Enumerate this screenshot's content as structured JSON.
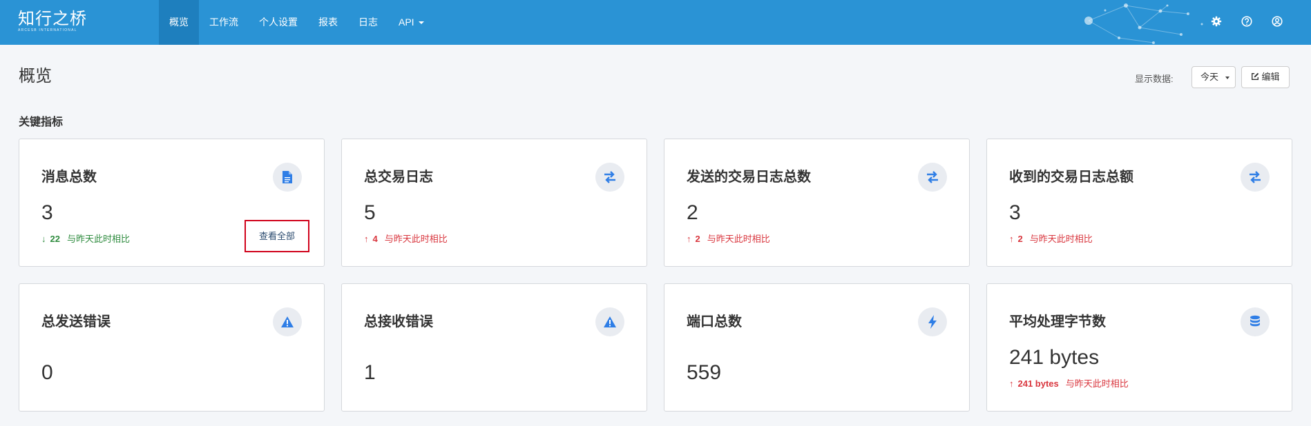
{
  "brand": {
    "name": "知行之桥",
    "subtitle": "ARCESB INTERNATIONAL"
  },
  "nav": {
    "items": [
      {
        "label": "概览",
        "active": true
      },
      {
        "label": "工作流",
        "active": false
      },
      {
        "label": "个人设置",
        "active": false
      },
      {
        "label": "报表",
        "active": false
      },
      {
        "label": "日志",
        "active": false
      }
    ],
    "api_label": "API"
  },
  "header_icons": [
    "gear-icon",
    "help-icon",
    "user-icon"
  ],
  "page": {
    "title": "概览",
    "display_label": "显示数据:",
    "period": "今天",
    "edit_label": "编辑",
    "section_title": "关键指标"
  },
  "cards": [
    {
      "title": "消息总数",
      "value": "3",
      "delta": "22",
      "direction": "down",
      "compare": "与昨天此时相比",
      "icon": "file-icon",
      "action": "查看全部"
    },
    {
      "title": "总交易日志",
      "value": "5",
      "delta": "4",
      "direction": "up",
      "compare": "与昨天此时相比",
      "icon": "exchange-icon"
    },
    {
      "title": "发送的交易日志总数",
      "value": "2",
      "delta": "2",
      "direction": "up",
      "compare": "与昨天此时相比",
      "icon": "exchange-icon"
    },
    {
      "title": "收到的交易日志总额",
      "value": "3",
      "delta": "2",
      "direction": "up",
      "compare": "与昨天此时相比",
      "icon": "exchange-icon"
    },
    {
      "title": "总发送错误",
      "value": "0",
      "icon": "warning-icon"
    },
    {
      "title": "总接收错误",
      "value": "1",
      "icon": "warning-icon"
    },
    {
      "title": "端口总数",
      "value": "559",
      "icon": "bolt-icon"
    },
    {
      "title": "平均处理字节数",
      "value": "241 bytes",
      "delta": "241 bytes",
      "direction": "up",
      "compare": "与昨天此时相比",
      "icon": "database-icon"
    }
  ],
  "colors": {
    "navbar": "#2a93d5",
    "nav_active": "#1e7fbe",
    "icon_blue": "#2f7ee6",
    "delta_down": "#2e8b3e",
    "delta_up": "#d9363e",
    "highlight": "#d0021b"
  }
}
